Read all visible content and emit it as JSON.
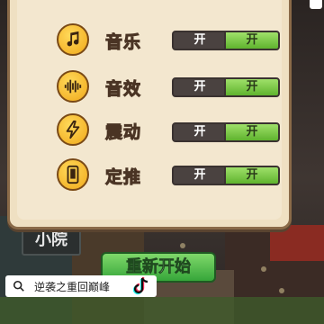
{
  "settings": {
    "rows": [
      {
        "label": "音乐",
        "icon": "music-note-icon",
        "off": "开",
        "on": "开"
      },
      {
        "label": "音效",
        "icon": "sound-wave-icon",
        "off": "开",
        "on": "开"
      },
      {
        "label": "震动",
        "icon": "lightning-icon",
        "off": "开",
        "on": "开"
      },
      {
        "label": "定推",
        "icon": "phone-icon",
        "off": "开",
        "on": "开"
      }
    ]
  },
  "scene": {
    "sign": "小院"
  },
  "restart_button": {
    "label": "重新开始"
  },
  "search": {
    "text": "逆袭之重回巅峰"
  },
  "colors": {
    "accent_green": "#5fb32e",
    "icon_gold": "#f0a81a",
    "panel": "#f3e7cf"
  }
}
